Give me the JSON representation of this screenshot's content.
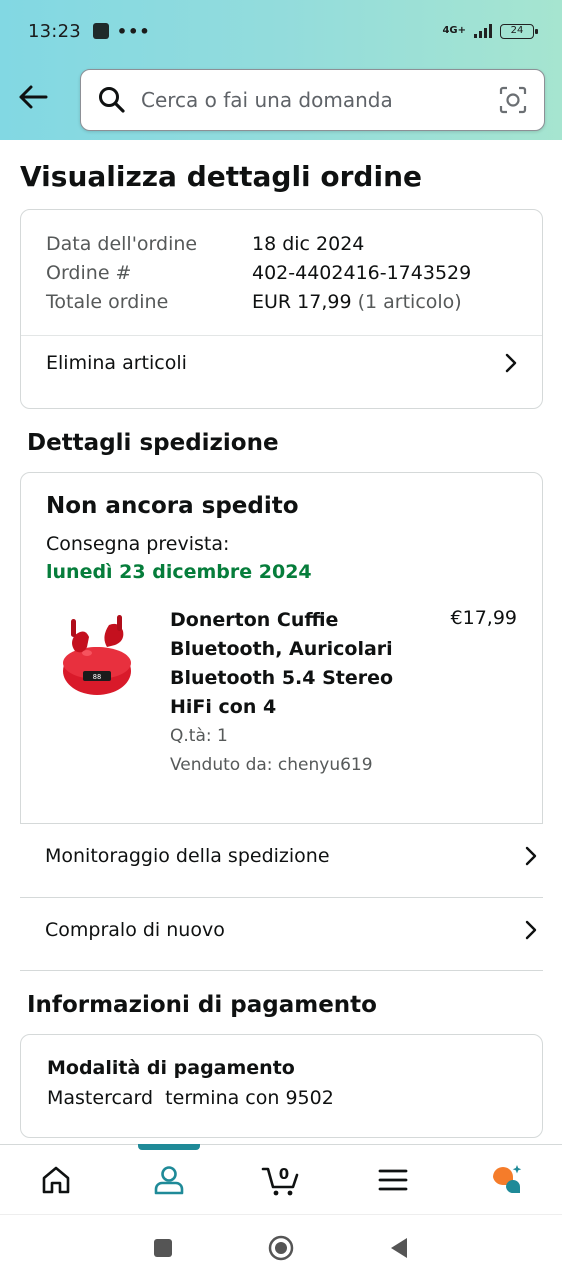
{
  "status_bar": {
    "time": "13:23",
    "dots": "•••",
    "network": "4G+",
    "battery": "24"
  },
  "header": {
    "search_placeholder": "Cerca o fai una domanda",
    "back_icon": "back-arrow-icon",
    "search_icon": "search-icon",
    "camera_icon": "camera-scan-icon"
  },
  "page": {
    "title": "Visualizza dettagli ordine"
  },
  "order_summary": {
    "rows": [
      {
        "label": "Data dell'ordine",
        "value": "18 dic 2024"
      },
      {
        "label": "Ordine #",
        "value": "402-4402416-1743529"
      },
      {
        "label": "Totale ordine",
        "value": "EUR 17,99",
        "extra": "(1 articolo)"
      }
    ],
    "delete_items_label": "Elimina articoli"
  },
  "shipping": {
    "section_title": "Dettagli spedizione",
    "status": "Non ancora spedito",
    "expected_label": "Consegna prevista:",
    "expected_date": "lunedì 23 dicembre 2024",
    "product": {
      "title": "Donerton Cuffie Bluetooth, Auricolari Bluetooth 5.4 Stereo HiFi con 4",
      "price": "€17,99",
      "qty": "Q.tà: 1",
      "seller": "Venduto da: chenyu619"
    },
    "track_label": "Monitoraggio della spedizione",
    "buy_again_label": "Compralo di nuovo"
  },
  "payment": {
    "section_title": "Informazioni di pagamento",
    "method_title": "Modalità di pagamento",
    "method_value": "Mastercard  termina con 9502"
  },
  "bottom_nav": {
    "cart_count": "0",
    "items": [
      "home-icon",
      "account-icon",
      "cart-icon",
      "menu-icon",
      "rufus-assistant-icon"
    ],
    "active": "account-icon"
  },
  "colors": {
    "accent": "#1f8a98",
    "delivery_green": "#067d3b",
    "assistant_orange": "#f57c2a"
  }
}
